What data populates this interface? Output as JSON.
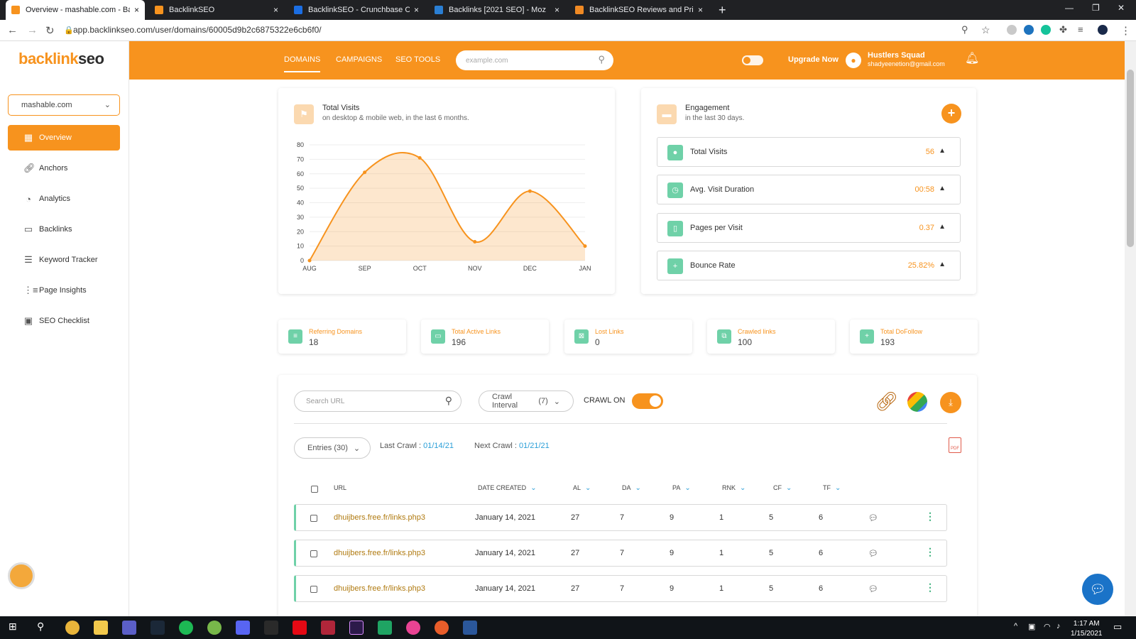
{
  "browser": {
    "tabs": [
      {
        "title": "Overview - mashable.com - Backl",
        "close": "×",
        "fav": "#f7931e"
      },
      {
        "title": "BacklinkSEO",
        "close": "×",
        "fav": "#f7931e"
      },
      {
        "title": "BacklinkSEO - Crunchbase Comp",
        "close": "×",
        "fav": "#1b6ee3"
      },
      {
        "title": "Backlinks [2021 SEO] - Moz",
        "close": "×",
        "fav": "#2a7fd4"
      },
      {
        "title": "BacklinkSEO Reviews and Pricing",
        "close": "×",
        "fav": "#f08a24"
      }
    ],
    "new_tab": "+",
    "url": "app.backlinkseo.com/user/domains/60005d9b2c6875322e6cb6f0/"
  },
  "brand": {
    "logo_part1": "backlink",
    "logo_part2": "seo"
  },
  "sidebar": {
    "domain_select": "mashable.com",
    "items": [
      {
        "label": "Overview",
        "icon": "grid-icon"
      },
      {
        "label": "Anchors",
        "icon": "link-icon"
      },
      {
        "label": "Analytics",
        "icon": "pie-icon"
      },
      {
        "label": "Backlinks",
        "icon": "tag-icon"
      },
      {
        "label": "Keyword Tracker",
        "icon": "list-icon"
      },
      {
        "label": "Page Insights",
        "icon": "columns-icon"
      },
      {
        "label": "SEO Checklist",
        "icon": "checklist-icon"
      }
    ]
  },
  "topnav": {
    "items": [
      "DOMAINS",
      "CAMPAIGNS",
      "SEO TOOLS"
    ],
    "search_placeholder": "example.com",
    "upgrade": "Upgrade Now",
    "user_name": "Hustlers Squad",
    "user_email": "shadyeenetion@gmail.com"
  },
  "visits_card": {
    "title": "Total Visits",
    "subtitle": "on desktop & mobile web, in the last 6 months."
  },
  "chart_data": {
    "type": "area",
    "categories": [
      "AUG",
      "SEP",
      "OCT",
      "NOV",
      "DEC",
      "JAN"
    ],
    "values": [
      0,
      61,
      71,
      13,
      48,
      10
    ],
    "yticks": [
      0,
      10,
      20,
      30,
      40,
      50,
      60,
      70,
      80
    ],
    "ylim": [
      0,
      80
    ],
    "grid": true,
    "color": "#f7931e"
  },
  "engagement": {
    "title": "Engagement",
    "subtitle": "in the last 30 days.",
    "rows": [
      {
        "label": "Total Visits",
        "value": "56"
      },
      {
        "label": "Avg. Visit Duration",
        "value": "00:58"
      },
      {
        "label": "Pages per Visit",
        "value": "0.37"
      },
      {
        "label": "Bounce Rate",
        "value": "25.82%"
      }
    ]
  },
  "stats": [
    {
      "label": "Referring Domains",
      "value": "18"
    },
    {
      "label": "Total Active Links",
      "value": "196"
    },
    {
      "label": "Lost Links",
      "value": "0"
    },
    {
      "label": "Crawled links",
      "value": "100"
    },
    {
      "label": "Total DoFollow",
      "value": "193"
    }
  ],
  "table_controls": {
    "search_placeholder": "Search URL",
    "crawl_interval_label": "Crawl Interval",
    "crawl_interval_value": "(7)",
    "crawl_on": "CRAWL ON",
    "entries_label": "Entries",
    "entries_value": "(30)",
    "last_crawl_label": "Last Crawl :",
    "last_crawl": "01/14/21",
    "next_crawl_label": "Next Crawl :",
    "next_crawl": "01/21/21"
  },
  "table": {
    "headers": [
      "URL",
      "DATE CREATED",
      "AL",
      "DA",
      "PA",
      "RNK",
      "CF",
      "TF"
    ],
    "rows": [
      {
        "url": "dhuijbers.free.fr/links.php3",
        "date": "January 14, 2021",
        "al": "27",
        "da": "7",
        "pa": "9",
        "rnk": "1",
        "cf": "5",
        "tf": "6"
      },
      {
        "url": "dhuijbers.free.fr/links.php3",
        "date": "January 14, 2021",
        "al": "27",
        "da": "7",
        "pa": "9",
        "rnk": "1",
        "cf": "5",
        "tf": "6"
      },
      {
        "url": "dhuijbers.free.fr/links.php3",
        "date": "January 14, 2021",
        "al": "27",
        "da": "7",
        "pa": "9",
        "rnk": "1",
        "cf": "5",
        "tf": "6"
      }
    ]
  },
  "taskbar": {
    "time": "1:17 AM",
    "date": "1/15/2021"
  }
}
